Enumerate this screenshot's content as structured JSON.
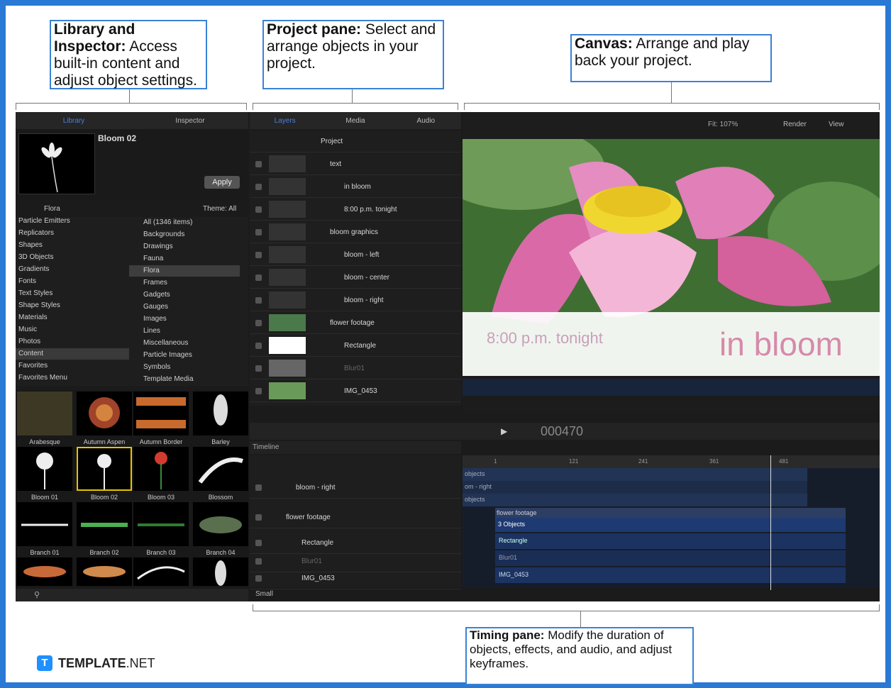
{
  "callouts": {
    "library": {
      "title": "Library and Inspector:",
      "text": "Access built-in content and adjust object settings."
    },
    "project": {
      "title": "Project pane:",
      "text": "Select and arrange objects in your project."
    },
    "canvas": {
      "title": "Canvas:",
      "text": "Arrange and play back your project."
    },
    "timing": {
      "title": "Timing pane:",
      "text": "Modify the duration of objects, effects, and audio, and adjust keyframes."
    }
  },
  "brand": {
    "name": "TEMPLATE",
    "suffix": ".NET"
  },
  "library_panel": {
    "tabs": [
      "Library",
      "Inspector"
    ],
    "preview_title": "Bloom 02",
    "apply_label": "Apply",
    "theme_label": "Theme: All",
    "category_selector": "Flora",
    "categories": [
      "Particle Emitters",
      "Replicators",
      "Shapes",
      "3D Objects",
      "Gradients",
      "Fonts",
      "Text Styles",
      "Shape Styles",
      "Materials",
      "Music",
      "Photos",
      "Content",
      "Favorites",
      "Favorites Menu"
    ],
    "subcategories": [
      "All (1346 items)",
      "Backgrounds",
      "Drawings",
      "Fauna",
      "Flora",
      "Frames",
      "Gadgets",
      "Gauges",
      "Images",
      "Lines",
      "Miscellaneous",
      "Particle Images",
      "Symbols",
      "Template Media"
    ],
    "tiles": [
      "Arabesque",
      "Autumn Aspen",
      "Autumn Border",
      "Barley",
      "Bloom 01",
      "Bloom 02",
      "Bloom 03",
      "Blossom",
      "Branch 01",
      "Branch 02",
      "Branch 03",
      "Branch 04",
      "",
      "",
      "",
      ""
    ]
  },
  "layers_panel": {
    "tabs": [
      "Layers",
      "Media",
      "Audio"
    ],
    "rows": [
      "Project",
      "text",
      "in bloom",
      "8:00 p.m. tonight",
      "bloom graphics",
      "bloom - left",
      "bloom - center",
      "bloom - right",
      "flower footage",
      "Rectangle",
      "Blur01",
      "IMG_0453"
    ]
  },
  "canvas_panel": {
    "toolbar": [
      "Fit: 107%",
      "Render",
      "View"
    ],
    "overlay_small": "8:00 p.m. tonight",
    "overlay_big": "in bloom",
    "timecode": "000470"
  },
  "timeline_panel": {
    "title": "Timeline",
    "rows": [
      "bloom - right",
      "flower footage",
      "Rectangle",
      "Blur01",
      "IMG_0453"
    ],
    "size_label": "Small",
    "ruler": [
      "1",
      "121",
      "241",
      "361",
      "481"
    ],
    "bars": [
      "objects",
      "om - right",
      "objects",
      "flower footage",
      "3 Objects",
      "Rectangle",
      "Blur01",
      "IMG_0453"
    ]
  }
}
